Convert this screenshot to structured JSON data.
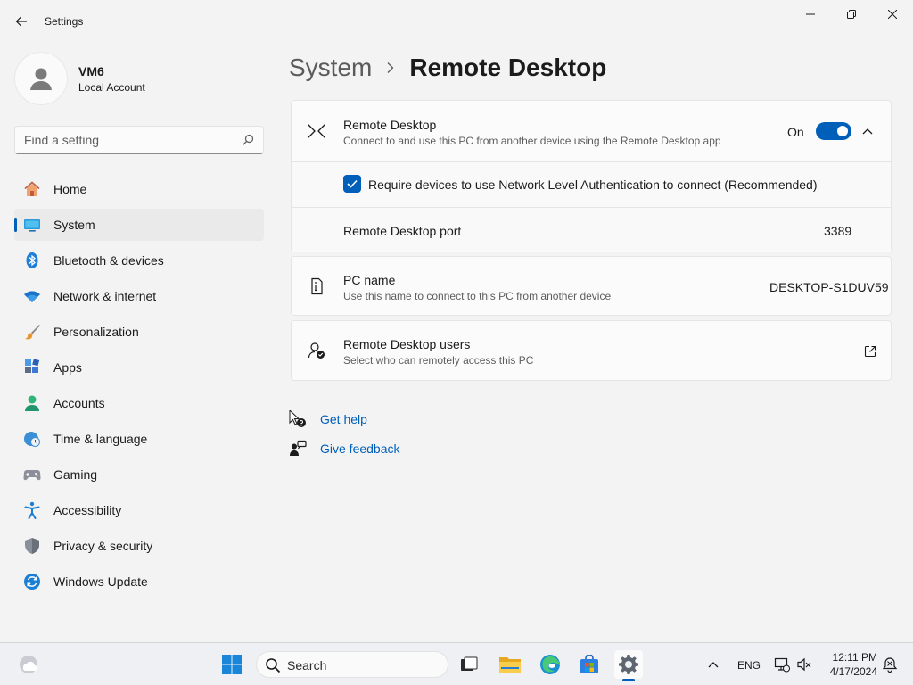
{
  "window": {
    "app_title": "Settings",
    "back_icon": "arrow-left-icon",
    "minimize_icon": "minimize-icon",
    "maximize_icon": "restore-icon",
    "close_icon": "close-icon"
  },
  "profile": {
    "name": "VM6",
    "account_type": "Local Account"
  },
  "search": {
    "placeholder": "Find a setting",
    "icon": "search-icon"
  },
  "sidebar": {
    "items": [
      {
        "label": "Home",
        "icon": "home-icon",
        "active": false
      },
      {
        "label": "System",
        "icon": "system-icon",
        "active": true
      },
      {
        "label": "Bluetooth & devices",
        "icon": "bluetooth-icon",
        "active": false
      },
      {
        "label": "Network & internet",
        "icon": "wifi-icon",
        "active": false
      },
      {
        "label": "Personalization",
        "icon": "brush-icon",
        "active": false
      },
      {
        "label": "Apps",
        "icon": "apps-icon",
        "active": false
      },
      {
        "label": "Accounts",
        "icon": "accounts-icon",
        "active": false
      },
      {
        "label": "Time & language",
        "icon": "globe-clock-icon",
        "active": false
      },
      {
        "label": "Gaming",
        "icon": "gamepad-icon",
        "active": false
      },
      {
        "label": "Accessibility",
        "icon": "accessibility-icon",
        "active": false
      },
      {
        "label": "Privacy & security",
        "icon": "shield-icon",
        "active": false
      },
      {
        "label": "Windows Update",
        "icon": "update-icon",
        "active": false
      }
    ]
  },
  "breadcrumb": {
    "parent": "System",
    "current": "Remote Desktop"
  },
  "remote_desktop": {
    "title": "Remote Desktop",
    "subtitle": "Connect to and use this PC from another device using the Remote Desktop app",
    "state_label": "On",
    "enabled": true,
    "nla_label": "Require devices to use Network Level Authentication to connect (Recommended)",
    "nla_checked": true,
    "port_label": "Remote Desktop port",
    "port_value": "3389"
  },
  "pc_name": {
    "title": "PC name",
    "subtitle": "Use this name to connect to this PC from another device",
    "value": "DESKTOP-S1DUV59"
  },
  "rd_users": {
    "title": "Remote Desktop users",
    "subtitle": "Select who can remotely access this PC",
    "action_icon": "open-external-icon"
  },
  "links": {
    "help": "Get help",
    "feedback": "Give feedback"
  },
  "taskbar": {
    "search_label": "Search",
    "language": "ENG",
    "time": "12:11 PM",
    "date": "4/17/2024",
    "accent_color": "#005fb8"
  }
}
